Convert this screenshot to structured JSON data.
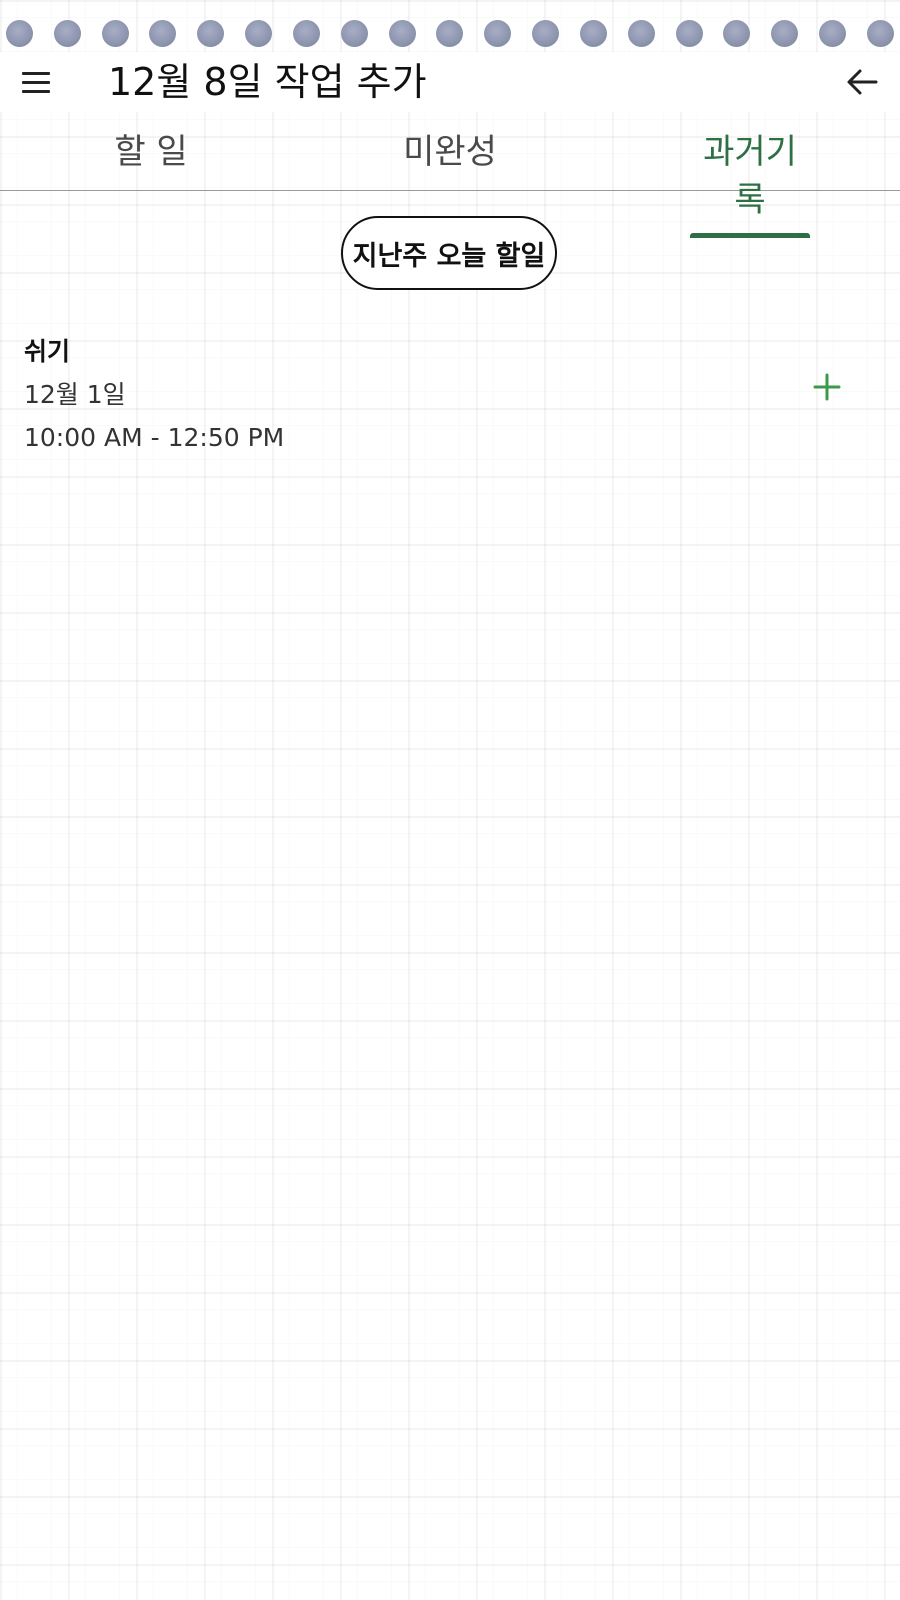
{
  "header": {
    "title": "12월 8일 작업 추가",
    "menu_icon": "hamburger-menu-icon",
    "back_icon": "arrow-left-icon"
  },
  "tabs": [
    {
      "label": "할 일",
      "active": false
    },
    {
      "label": "미완성",
      "active": false
    },
    {
      "label": "과거기록",
      "active": true
    }
  ],
  "filter_button": {
    "label": "지난주 오늘 할일"
  },
  "history": {
    "items": [
      {
        "title": "쉬기",
        "date": "12월 1일",
        "time": "10:00 AM - 12:50 PM",
        "action_icon": "plus-icon"
      }
    ]
  },
  "colors": {
    "accent": "#2e6f46",
    "add_icon": "#3a9a4a",
    "binding_hole": "#8f96b0"
  }
}
